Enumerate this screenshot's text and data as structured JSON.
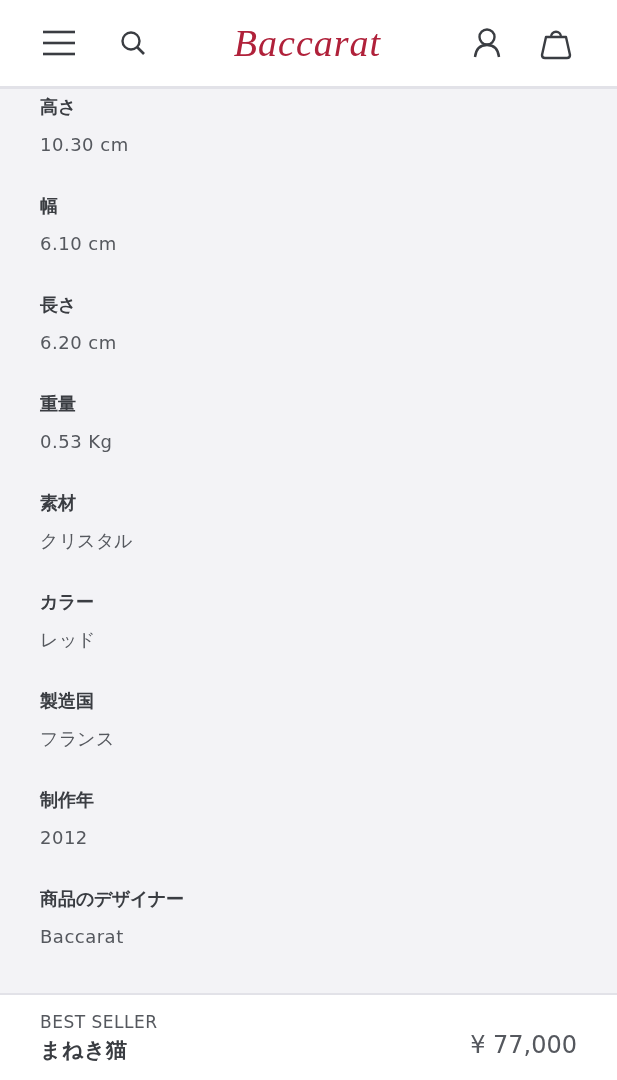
{
  "header": {
    "logo": "Baccarat"
  },
  "specs": [
    {
      "label": "高さ",
      "value": "10.30 cm"
    },
    {
      "label": "幅",
      "value": "6.10 cm"
    },
    {
      "label": "長さ",
      "value": "6.20 cm"
    },
    {
      "label": "重量",
      "value": "0.53 Kg"
    },
    {
      "label": "素材",
      "value": "クリスタル"
    },
    {
      "label": "カラー",
      "value": "レッド"
    },
    {
      "label": "製造国",
      "value": "フランス"
    },
    {
      "label": "制作年",
      "value": "2012"
    },
    {
      "label": "商品のデザイナー",
      "value": "Baccarat"
    }
  ],
  "footer": {
    "badge": "BEST SELLER",
    "product": "まねき猫",
    "price": "¥ 77,000"
  }
}
